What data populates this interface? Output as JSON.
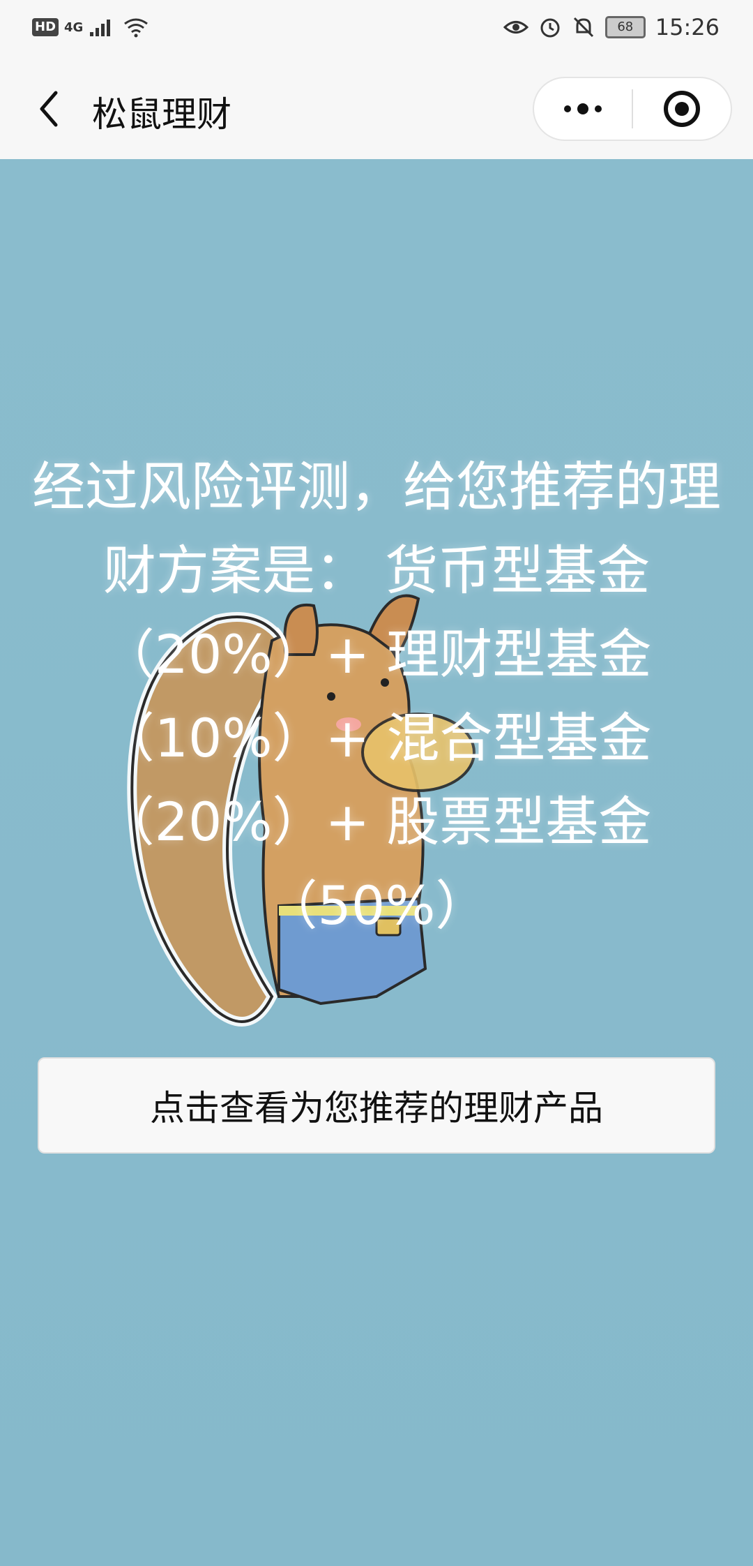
{
  "status_bar": {
    "left_badge": "HD",
    "network": "4G",
    "battery": "68",
    "time": "15:26"
  },
  "nav": {
    "title": "松鼠理财"
  },
  "main": {
    "result_text": "经过风险评测，给您推荐的理财方案是： 货币型基金（20%）+ 理财型基金（10%）+ 混合型基金（20%）+ 股票型基金（50%）",
    "cta_label": "点击查看为您推荐的理财产品"
  },
  "colors": {
    "background": "#87b9cb",
    "bar": "#f7f7f7"
  }
}
